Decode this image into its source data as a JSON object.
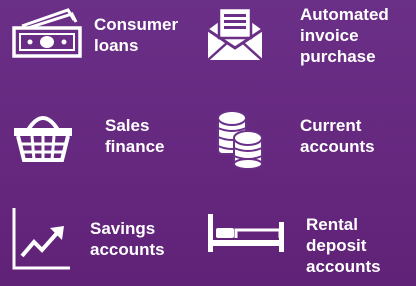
{
  "colors": {
    "background": "#6a2f87",
    "foreground": "#ffffff"
  },
  "items": [
    {
      "label": "Consumer\nloans",
      "icon": "banknotes-icon"
    },
    {
      "label": "Automated\ninvoice\npurchase",
      "icon": "envelope-invoice-icon"
    },
    {
      "label": "Sales\nfinance",
      "icon": "shopping-basket-icon"
    },
    {
      "label": "Current\naccounts",
      "icon": "coins-icon"
    },
    {
      "label": "Savings\naccounts",
      "icon": "trending-chart-icon"
    },
    {
      "label": "Rental\ndeposit\naccounts",
      "icon": "bed-icon"
    }
  ]
}
